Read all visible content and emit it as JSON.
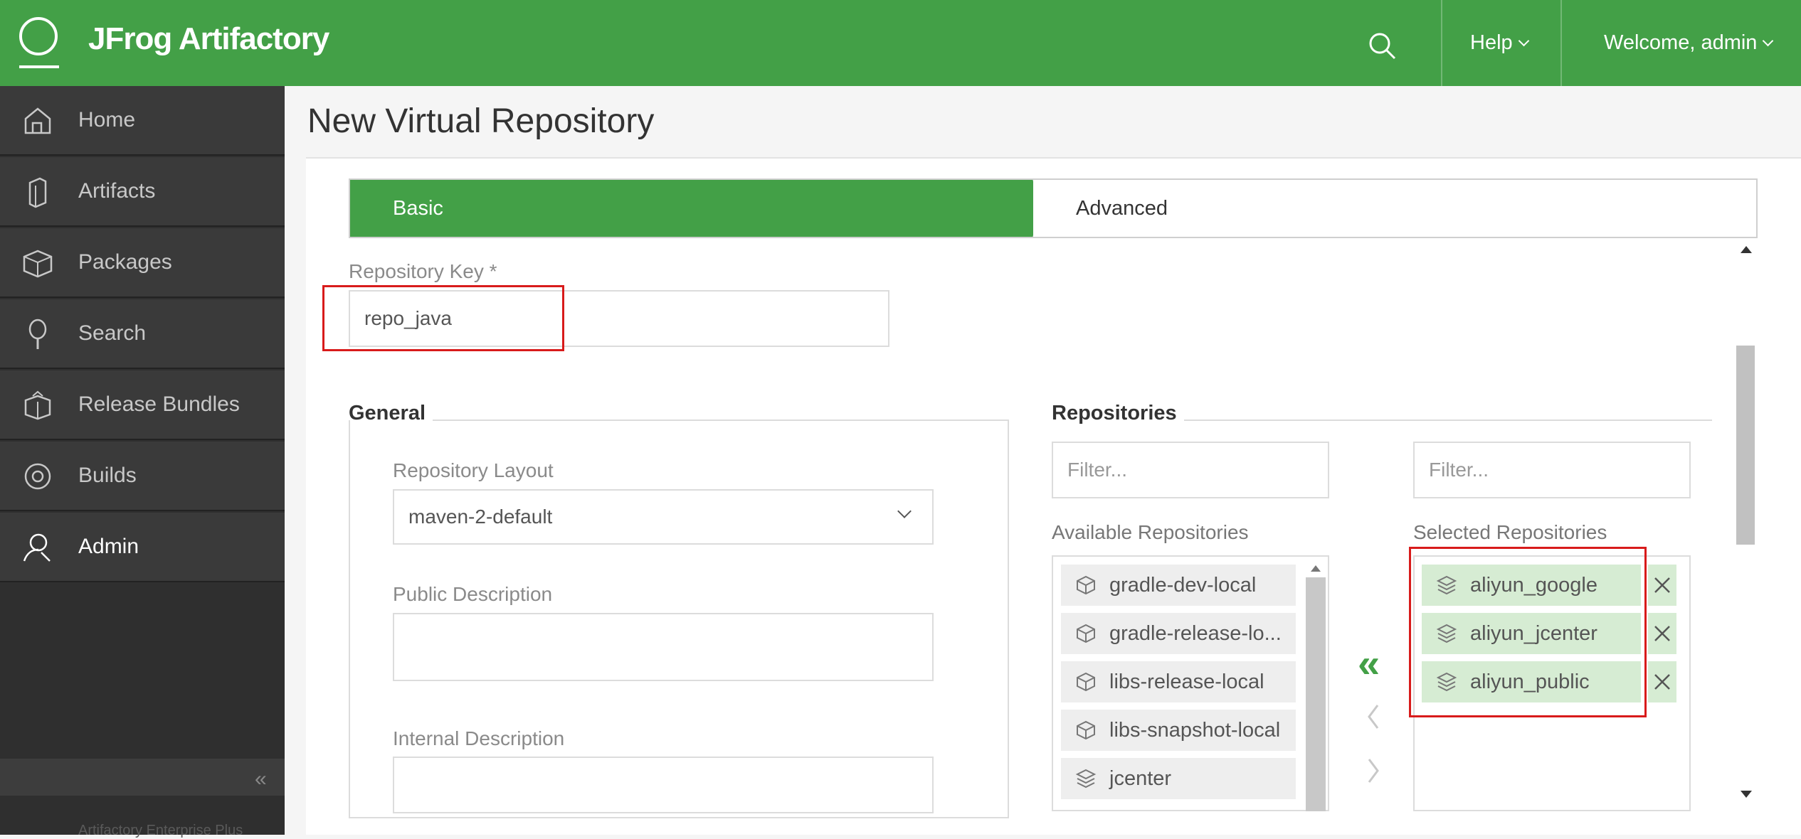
{
  "header": {
    "brand": "JFrog Artifactory",
    "help_label": "Help",
    "welcome_label": "Welcome, admin"
  },
  "sidebar": {
    "items": [
      {
        "label": "Home",
        "icon": "home-icon"
      },
      {
        "label": "Artifacts",
        "icon": "artifacts-icon"
      },
      {
        "label": "Packages",
        "icon": "packages-icon"
      },
      {
        "label": "Search",
        "icon": "search-icon"
      },
      {
        "label": "Release Bundles",
        "icon": "release-bundles-icon"
      },
      {
        "label": "Builds",
        "icon": "builds-icon"
      },
      {
        "label": "Admin",
        "icon": "admin-icon"
      }
    ],
    "active": "Admin",
    "edition": "Artifactory Enterprise Plus"
  },
  "page": {
    "title": "New Virtual Repository"
  },
  "wizard": {
    "steps": [
      "Basic",
      "Advanced"
    ],
    "active_step": "Basic"
  },
  "form": {
    "repo_key_label": "Repository Key *",
    "repo_key_value": "repo_java",
    "general_title": "General",
    "layout_label": "Repository Layout",
    "layout_value": "maven-2-default",
    "public_desc_label": "Public Description",
    "internal_desc_label": "Internal Description"
  },
  "repositories": {
    "title": "Repositories",
    "filter_placeholder": "Filter...",
    "available_label": "Available Repositories",
    "selected_label": "Selected Repositories",
    "available": [
      {
        "name": "gradle-dev-local",
        "icon": "local-repo-icon"
      },
      {
        "name": "gradle-release-lo...",
        "icon": "local-repo-icon"
      },
      {
        "name": "libs-release-local",
        "icon": "local-repo-icon"
      },
      {
        "name": "libs-snapshot-local",
        "icon": "local-repo-icon"
      },
      {
        "name": "jcenter",
        "icon": "remote-repo-icon"
      }
    ],
    "selected": [
      {
        "name": "aliyun_google",
        "icon": "remote-repo-icon"
      },
      {
        "name": "aliyun_jcenter",
        "icon": "remote-repo-icon"
      },
      {
        "name": "aliyun_public",
        "icon": "remote-repo-icon"
      }
    ]
  },
  "colors": {
    "brand_green": "#43a047",
    "sidebar_bg": "#3a3a3a",
    "selected_item_bg": "#d6ecd3",
    "highlight_red": "#d81b1b"
  }
}
